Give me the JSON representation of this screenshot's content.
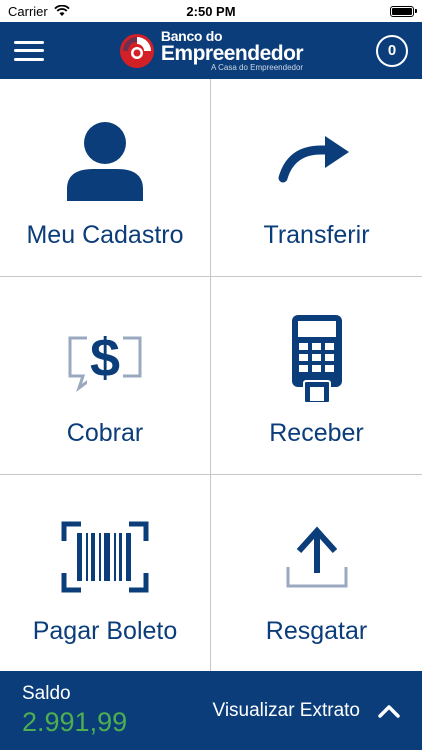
{
  "status_bar": {
    "carrier": "Carrier",
    "time": "2:50 PM"
  },
  "header": {
    "brand_line1": "Banco do",
    "brand_line2": "Empreendedor",
    "brand_tagline": "A Casa do Empreendedor",
    "notification_count": "0"
  },
  "tiles": [
    {
      "label": "Meu Cadastro",
      "icon": "user-icon"
    },
    {
      "label": "Transferir",
      "icon": "redo-arrow-icon"
    },
    {
      "label": "Cobrar",
      "icon": "dollar-chat-icon"
    },
    {
      "label": "Receber",
      "icon": "card-terminal-icon"
    },
    {
      "label": "Pagar Boleto",
      "icon": "barcode-scan-icon"
    },
    {
      "label": "Resgatar",
      "icon": "upload-icon"
    }
  ],
  "footer": {
    "saldo_label": "Saldo",
    "saldo_value": "2.991,99",
    "extrato_label": "Visualizar Extrato"
  },
  "colors": {
    "primary": "#0b3d7a",
    "balance": "#4caf50",
    "divider": "#c8c8c8"
  }
}
